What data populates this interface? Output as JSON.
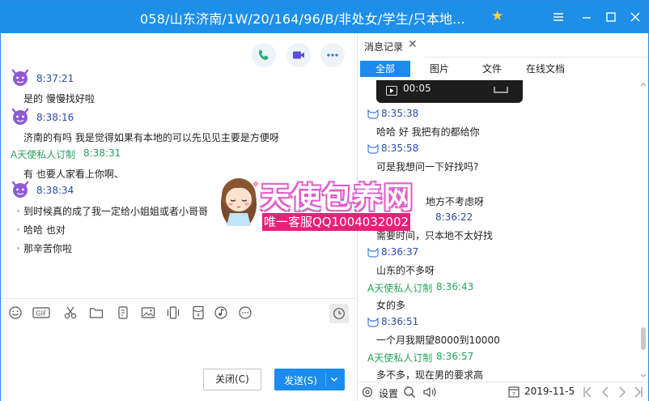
{
  "window": {
    "title": "058/山东济南/1W/20/164/96/B/非处女/学生/只本地...",
    "brand_color": "#1e8fe8"
  },
  "chat": {
    "messages": [
      {
        "sender": "",
        "time": "8:37:21",
        "lines": [
          "是的  慢慢找好啦"
        ]
      },
      {
        "sender": "",
        "time": "8:38:16",
        "lines": [
          "济南的有吗 我是觉得如果有本地的可以先见见主要是方便呀"
        ]
      },
      {
        "sender": "A天使私人订制",
        "time": "8:38:31",
        "lines": [
          "有  也要人家看上你啊、"
        ]
      },
      {
        "sender": "",
        "time": "8:38:34",
        "lines": [
          "到时候真的成了我一定给小姐姐或者小哥哥",
          "哈哈 也对",
          "那辛苦你啦"
        ]
      }
    ],
    "toolbar_icons": [
      "emoji-icon",
      "gif-icon",
      "scissors-icon",
      "folder-icon",
      "shake-icon",
      "image-icon",
      "phone-shake-icon",
      "red-packet-icon",
      "music-icon",
      "more-icon"
    ],
    "close_label": "关闭(C)",
    "send_label": "发送(S)"
  },
  "watermark": {
    "title": "天使包养网",
    "subtitle": "唯一客服QQ1004032002"
  },
  "history": {
    "tab_label": "消息记录",
    "filters": [
      "全部",
      "图片",
      "文件",
      "在线文档"
    ],
    "active_filter": "全部",
    "video_duration": "00:05",
    "entries": [
      {
        "sender": "",
        "time": "8:35:38",
        "text": "哈哈 好 我把有的都给你"
      },
      {
        "sender": "",
        "time": "8:35:58",
        "text": "可是我想问一下好找吗?"
      },
      {
        "sender": "",
        "time": "",
        "text": "地方不考虑呀"
      },
      {
        "sender": "",
        "time": "8:36:22",
        "text": "需要时间，只本地不太好找"
      },
      {
        "sender": "",
        "time": "8:36:37",
        "text": "山东的不多呀"
      },
      {
        "sender": "A天使私人订制",
        "time": "8:36:43",
        "text": "女的多"
      },
      {
        "sender": "",
        "time": "8:36:51",
        "text": "一个月我期望8000到10000"
      },
      {
        "sender": "A天使私人订制",
        "time": "8:36:57",
        "text": "多不多，现在男的要求高"
      }
    ],
    "footer": {
      "settings_label": "设置",
      "date": "2019-11-5"
    }
  }
}
